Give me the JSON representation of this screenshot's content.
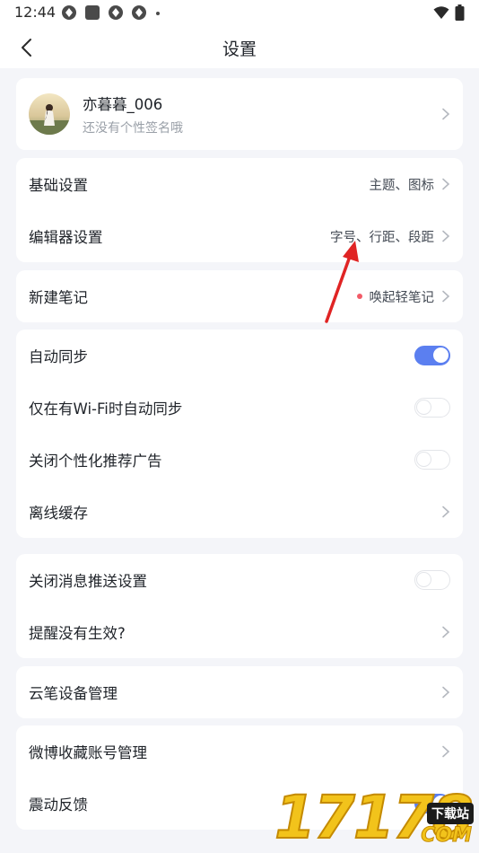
{
  "status_bar": {
    "time": "12:44",
    "icons": [
      "app-icon",
      "app-icon",
      "app-icon",
      "app-icon",
      "dot"
    ],
    "right_icons": [
      "wifi-icon",
      "battery-icon"
    ]
  },
  "header": {
    "title": "设置",
    "back_icon": "chevron-left-icon"
  },
  "profile": {
    "name": "亦暮暮_006",
    "signature": "还没有个性签名哦"
  },
  "basic_group": [
    {
      "label": "基础设置",
      "value": "主题、图标"
    },
    {
      "label": "编辑器设置",
      "value": "字号、行距、段距"
    }
  ],
  "new_note": {
    "label": "新建笔记",
    "value": "唤起轻笔记",
    "dot_color": "#f25b67"
  },
  "sync_group": {
    "auto_sync": {
      "label": "自动同步",
      "on": true
    },
    "wifi_sync": {
      "label": "仅在有Wi-Fi时自动同步",
      "on": false
    },
    "close_ads": {
      "label": "关闭个性化推荐广告",
      "on": false
    },
    "offline_cache": {
      "label": "离线缓存"
    }
  },
  "push_group": {
    "close_push": {
      "label": "关闭消息推送设置",
      "on": false
    },
    "reminder": {
      "label": "提醒没有生效?"
    }
  },
  "device_group": {
    "pen_manage": {
      "label": "云笔设备管理"
    }
  },
  "misc_group": {
    "weibo": {
      "label": "微博收藏账号管理"
    },
    "vibration": {
      "label": "震动反馈",
      "on": true
    }
  },
  "watermark": {
    "digits": "17178",
    "badge": "下载站",
    "domain": "COM"
  },
  "colors": {
    "accent": "#5b7ff0",
    "background": "#f4f5f9",
    "annotation": "#e02424"
  }
}
